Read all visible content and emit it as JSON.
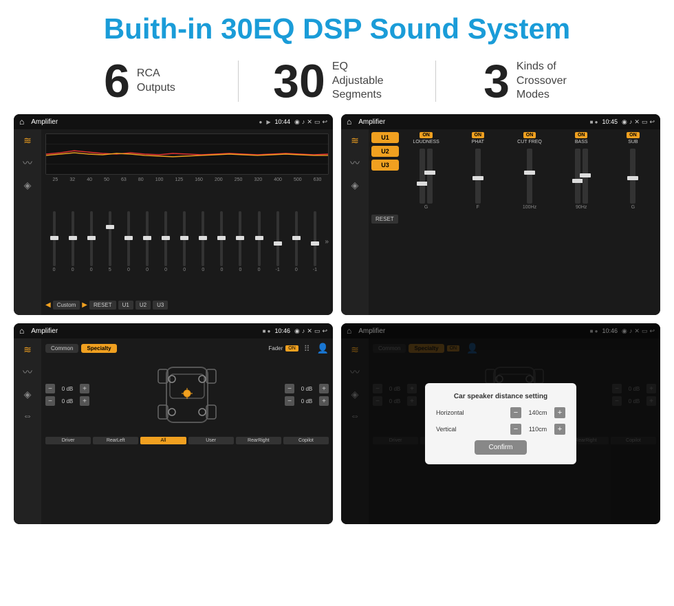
{
  "header": {
    "title": "Buith-in 30EQ DSP Sound System"
  },
  "stats": [
    {
      "number": "6",
      "text": "RCA\nOutputs"
    },
    {
      "number": "30",
      "text": "EQ Adjustable\nSegments"
    },
    {
      "number": "3",
      "text": "Kinds of\nCrossover Modes"
    }
  ],
  "screens": {
    "eq": {
      "title": "Amplifier",
      "time": "10:44",
      "freqs": [
        "25",
        "32",
        "40",
        "50",
        "63",
        "80",
        "100",
        "125",
        "160",
        "200",
        "250",
        "320",
        "400",
        "500",
        "630"
      ],
      "values": [
        "0",
        "0",
        "0",
        "5",
        "0",
        "0",
        "0",
        "0",
        "0",
        "0",
        "0",
        "0",
        "-1",
        "0",
        "-1"
      ],
      "preset": "Custom",
      "buttons": [
        "RESET",
        "U1",
        "U2",
        "U3"
      ]
    },
    "crossover": {
      "title": "Amplifier",
      "time": "10:45",
      "presets": [
        "U1",
        "U2",
        "U3"
      ],
      "sections": [
        "LOUDNESS",
        "PHAT",
        "CUT FREQ",
        "BASS",
        "SUB"
      ],
      "resetLabel": "RESET"
    },
    "speaker": {
      "title": "Amplifier",
      "time": "10:46",
      "tabs": [
        "Common",
        "Specialty"
      ],
      "faderLabel": "Fader",
      "onLabel": "ON",
      "volumes": [
        "0 dB",
        "0 dB",
        "0 dB",
        "0 dB"
      ],
      "buttons": [
        "Driver",
        "RearLeft",
        "All",
        "User",
        "RearRight",
        "Copilot"
      ]
    },
    "speakerDialog": {
      "title": "Amplifier",
      "time": "10:46",
      "tabs": [
        "Common",
        "Specialty"
      ],
      "onLabel": "ON",
      "dialogTitle": "Car speaker distance setting",
      "horizontal": "140cm",
      "vertical": "110cm",
      "horizontalLabel": "Horizontal",
      "verticalLabel": "Vertical",
      "confirmLabel": "Confirm",
      "buttons": [
        "Driver",
        "RearLeft..",
        "All",
        "User",
        "RearRight",
        "Copilot"
      ]
    }
  },
  "icons": {
    "home": "⌂",
    "back": "↩",
    "location": "◎",
    "camera": "📷",
    "volume": "🔊",
    "close": "✕",
    "minimize": "—",
    "eq_icon": "≋",
    "wave_icon": "〰",
    "speaker_icon": "◈",
    "arrows_icon": "⟪⟫"
  }
}
